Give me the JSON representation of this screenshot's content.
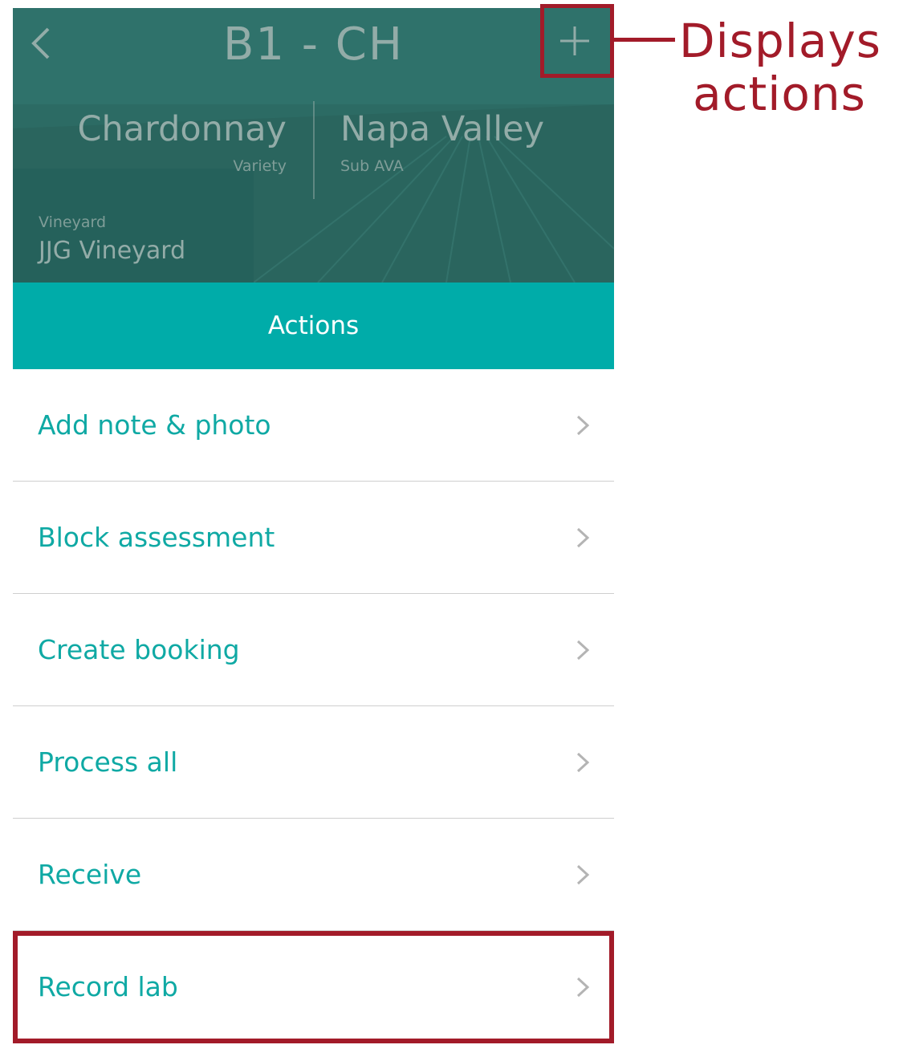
{
  "header": {
    "title": "B1 - CH",
    "back_icon": "chevron-left-icon",
    "add_icon": "plus-icon",
    "variety": {
      "value": "Chardonnay",
      "label": "Variety"
    },
    "sub_ava": {
      "value": "Napa Valley",
      "label": "Sub AVA"
    },
    "vineyard": {
      "label": "Vineyard",
      "value": "JJG Vineyard"
    }
  },
  "actions": {
    "title": "Actions",
    "items": [
      {
        "label": "Add note & photo"
      },
      {
        "label": "Block assessment"
      },
      {
        "label": "Create booking"
      },
      {
        "label": "Process all"
      },
      {
        "label": "Receive"
      },
      {
        "label": "Record lab"
      }
    ]
  },
  "annotation": {
    "callout_line1": "Displays",
    "callout_line2": "actions"
  },
  "colors": {
    "accent": "#00aca9",
    "highlight": "#a21b29",
    "header_overlay": "#2a6a63"
  }
}
